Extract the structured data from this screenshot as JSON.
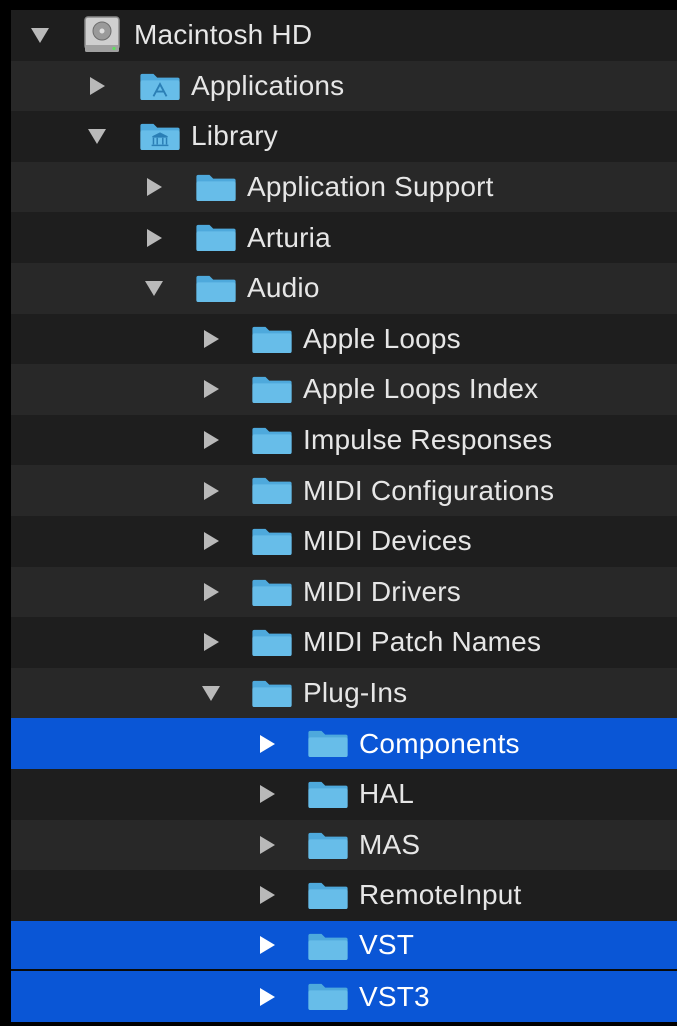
{
  "colors": {
    "background": "#000000",
    "row_dark": "#1e1e1e",
    "row_light": "#282828",
    "selection": "#0a56d6",
    "folder": "#5fb7e6",
    "text": "#e6e6e6"
  },
  "tree": {
    "rows": [
      {
        "label": "Macintosh HD",
        "icon": "hard-drive-icon",
        "expanded": true,
        "selected": false
      },
      {
        "label": "Applications",
        "icon": "applications-folder-icon",
        "expanded": false,
        "selected": false
      },
      {
        "label": "Library",
        "icon": "library-folder-icon",
        "expanded": true,
        "selected": false
      },
      {
        "label": "Application Support",
        "icon": "folder-icon",
        "expanded": false,
        "selected": false
      },
      {
        "label": "Arturia",
        "icon": "folder-icon",
        "expanded": false,
        "selected": false
      },
      {
        "label": "Audio",
        "icon": "folder-icon",
        "expanded": true,
        "selected": false
      },
      {
        "label": "Apple Loops",
        "icon": "folder-icon",
        "expanded": false,
        "selected": false
      },
      {
        "label": "Apple Loops Index",
        "icon": "folder-icon",
        "expanded": false,
        "selected": false
      },
      {
        "label": "Impulse Responses",
        "icon": "folder-icon",
        "expanded": false,
        "selected": false
      },
      {
        "label": "MIDI Configurations",
        "icon": "folder-icon",
        "expanded": false,
        "selected": false
      },
      {
        "label": "MIDI Devices",
        "icon": "folder-icon",
        "expanded": false,
        "selected": false
      },
      {
        "label": "MIDI Drivers",
        "icon": "folder-icon",
        "expanded": false,
        "selected": false
      },
      {
        "label": "MIDI Patch Names",
        "icon": "folder-icon",
        "expanded": false,
        "selected": false
      },
      {
        "label": "Plug-Ins",
        "icon": "folder-icon",
        "expanded": true,
        "selected": false
      },
      {
        "label": "Components",
        "icon": "folder-icon",
        "expanded": false,
        "selected": true
      },
      {
        "label": "HAL",
        "icon": "folder-icon",
        "expanded": false,
        "selected": false
      },
      {
        "label": "MAS",
        "icon": "folder-icon",
        "expanded": false,
        "selected": false
      },
      {
        "label": "RemoteInput",
        "icon": "folder-icon",
        "expanded": false,
        "selected": false
      },
      {
        "label": "VST",
        "icon": "folder-icon",
        "expanded": false,
        "selected": true
      },
      {
        "label": "VST3",
        "icon": "folder-icon",
        "expanded": false,
        "selected": true
      }
    ]
  }
}
